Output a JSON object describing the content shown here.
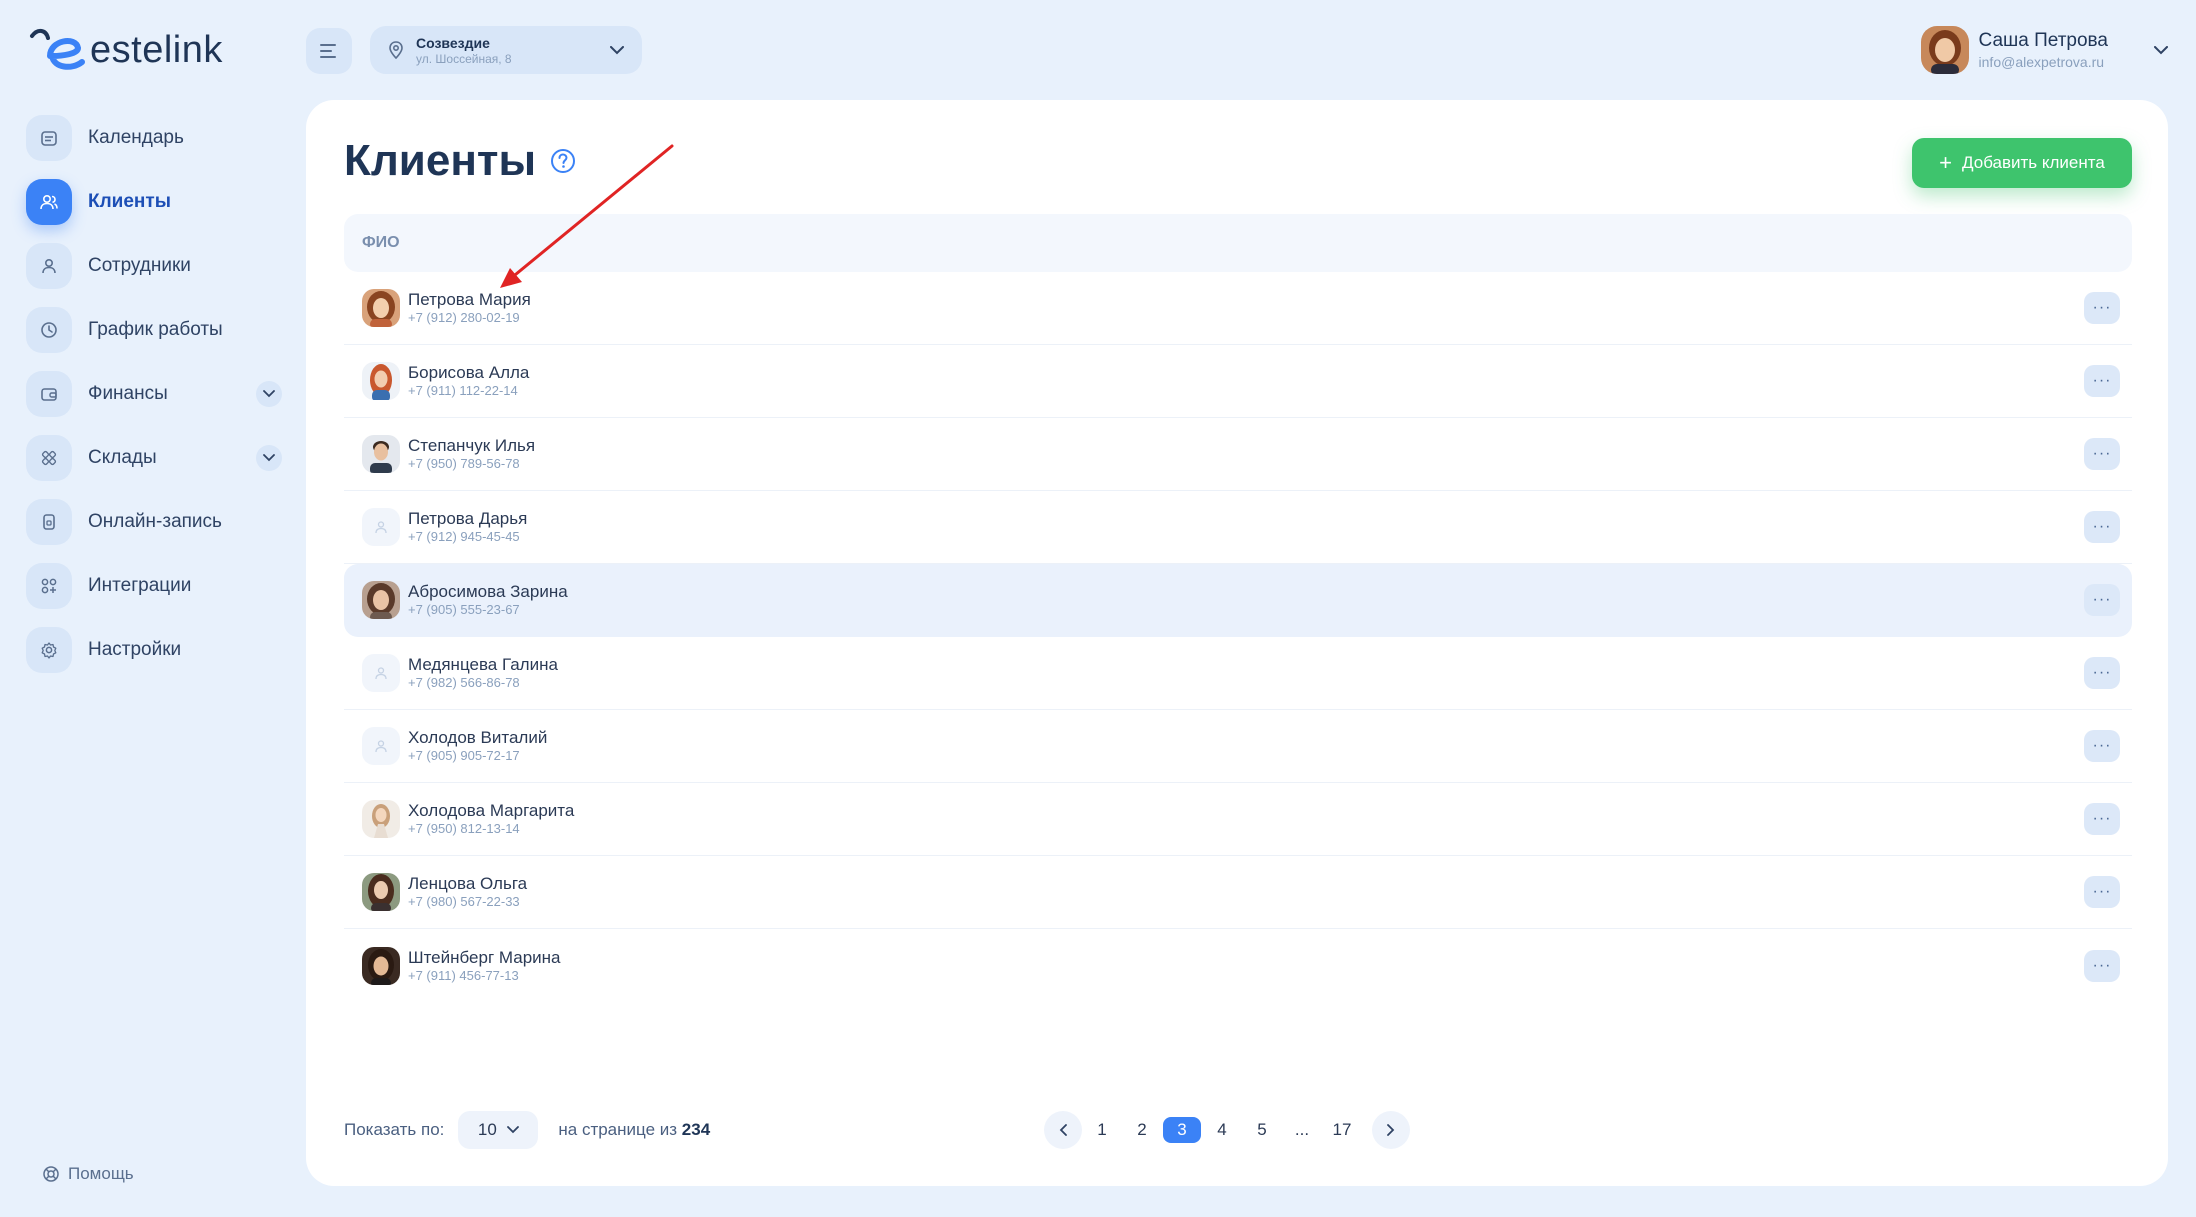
{
  "app": {
    "name": "estelink"
  },
  "header": {
    "location": {
      "name": "Созвездие",
      "address": "ул. Шоссейная, 8"
    },
    "user": {
      "name": "Саша Петрова",
      "email": "info@alexpetrova.ru"
    }
  },
  "sidebar": {
    "items": [
      {
        "label": "Календарь",
        "icon": "calendar-icon",
        "active": false,
        "expandable": false
      },
      {
        "label": "Клиенты",
        "icon": "users-icon",
        "active": true,
        "expandable": false
      },
      {
        "label": "Сотрудники",
        "icon": "user-icon",
        "active": false,
        "expandable": false
      },
      {
        "label": "График работы",
        "icon": "clock-icon",
        "active": false,
        "expandable": false
      },
      {
        "label": "Финансы",
        "icon": "wallet-icon",
        "active": false,
        "expandable": true
      },
      {
        "label": "Склады",
        "icon": "boxes-icon",
        "active": false,
        "expandable": true
      },
      {
        "label": "Онлайн-запись",
        "icon": "phone-icon",
        "active": false,
        "expandable": false
      },
      {
        "label": "Интеграции",
        "icon": "grid-plus-icon",
        "active": false,
        "expandable": false
      },
      {
        "label": "Настройки",
        "icon": "gear-icon",
        "active": false,
        "expandable": false
      }
    ],
    "help_label": "Помощь"
  },
  "main": {
    "title": "Клиенты",
    "add_button": "Добавить клиента",
    "table": {
      "column": "ФИО",
      "rows": [
        {
          "name": "Петрова Мария",
          "phone": "+7 (912) 280-02-19",
          "avatar": "photo"
        },
        {
          "name": "Борисова Алла",
          "phone": "+7 (911) 112-22-14",
          "avatar": "photo"
        },
        {
          "name": "Степанчук Илья",
          "phone": "+7 (950) 789-56-78",
          "avatar": "photo"
        },
        {
          "name": "Петрова Дарья",
          "phone": "+7 (912) 945-45-45",
          "avatar": "empty"
        },
        {
          "name": "Абросимова Зарина",
          "phone": "+7 (905) 555-23-67",
          "avatar": "photo",
          "highlight": true
        },
        {
          "name": "Медянцева Галина",
          "phone": "+7 (982) 566-86-78",
          "avatar": "empty"
        },
        {
          "name": "Холодов Виталий",
          "phone": "+7 (905) 905-72-17",
          "avatar": "empty"
        },
        {
          "name": "Холодова Маргарита",
          "phone": "+7 (950) 812-13-14",
          "avatar": "photo"
        },
        {
          "name": "Ленцова Ольга",
          "phone": "+7 (980) 567-22-33",
          "avatar": "photo"
        },
        {
          "name": "Штейнберг Марина",
          "phone": "+7 (911) 456-77-13",
          "avatar": "photo"
        }
      ],
      "more_label": "···"
    },
    "footer": {
      "show_label": "Показать по:",
      "per_page": "10",
      "range_label": "на странице из",
      "total": "234"
    },
    "pagination": {
      "pages": [
        "1",
        "2",
        "3",
        "4",
        "5"
      ],
      "current": "3",
      "ellipsis": "...",
      "last": "17"
    }
  },
  "colors": {
    "accent": "#3b82f6",
    "success": "#3ec46d",
    "background": "#e8f1fc",
    "annotation": "#e02424"
  }
}
